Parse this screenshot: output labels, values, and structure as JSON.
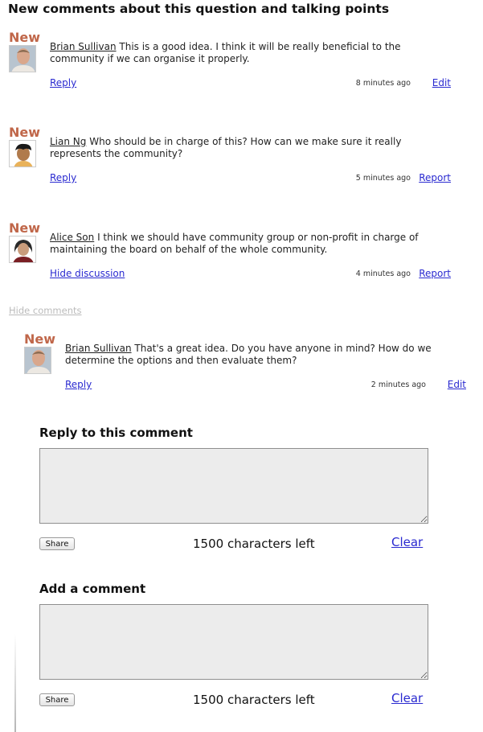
{
  "heading": "New comments about this question and talking points",
  "comments": [
    {
      "badge": "New",
      "author": "Brian Sullivan",
      "text": "This is a good idea. I think it will be really beneficial to the community if we can organise it properly.",
      "action": "Reply",
      "time": "8 minutes ago",
      "link": "Edit"
    },
    {
      "badge": "New",
      "author": "Lian Ng",
      "text": "Who should be in charge of this? How can we make sure it really represents the community?",
      "action": "Reply",
      "time": "5 minutes ago",
      "link": "Report"
    },
    {
      "badge": "New",
      "author": "Alice Son",
      "text": "I think we should have community group or non-profit in charge of maintaining the board on behalf of the whole community.",
      "action": "Hide discussion",
      "time": "4 minutes ago",
      "link": "Report"
    },
    {
      "badge": "New",
      "author": "Brian Sullivan",
      "text": "That's a great idea. Do you have anyone in mind? How do we determine the options and then evaluate them?",
      "action": "Reply",
      "time": "2 minutes ago",
      "link": "Edit"
    }
  ],
  "hide_comments": "Hide comments",
  "reply_form": {
    "title": "Reply to this comment",
    "share_label": "Share",
    "chars_left": "1500 characters left",
    "clear_label": "Clear"
  },
  "add_form": {
    "title": "Add a comment",
    "share_label": "Share",
    "chars_left": "1500 characters left",
    "clear_label": "Clear"
  },
  "colors": {
    "new_badge": "#c0674a",
    "link": "#2a2ad0",
    "muted_link": "#bbbbbb",
    "textarea_bg": "#ececec"
  }
}
